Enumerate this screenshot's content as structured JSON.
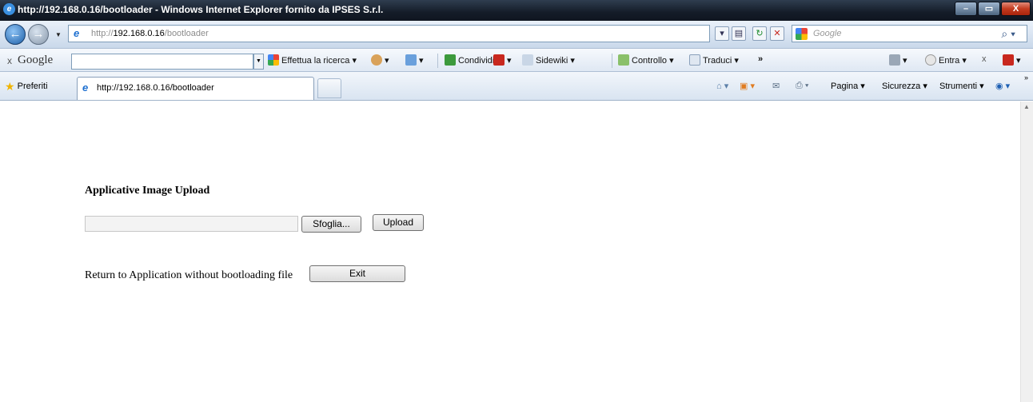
{
  "window": {
    "title": "http://192.168.0.16/bootloader - Windows Internet Explorer fornito da IPSES S.r.l.",
    "min": "–",
    "max": "▭",
    "close": "X"
  },
  "address": {
    "scheme": "http://",
    "host": "192.168.0.16",
    "path": "/bootloader"
  },
  "search": {
    "placeholder": "Google"
  },
  "google_toolbar": {
    "close": "x",
    "brand": "Google",
    "items": [
      "Effettua la ricerca ▾",
      "Condividi ▾",
      "Sidewiki ▾",
      "Controllo ▾",
      "Traduci ▾",
      "»",
      "Entra ▾"
    ]
  },
  "favorites": {
    "label": "Preferiti"
  },
  "tab": {
    "title": "http://192.168.0.16/bootloader"
  },
  "commandbar": {
    "items": [
      "Pagina ▾",
      "Sicurezza ▾",
      "Strumenti ▾"
    ]
  },
  "page": {
    "heading": "Applicative Image Upload",
    "browse_label": "Sfoglia...",
    "upload_label": "Upload",
    "return_text": "Return to Application without bootloading file",
    "exit_label": "Exit"
  }
}
